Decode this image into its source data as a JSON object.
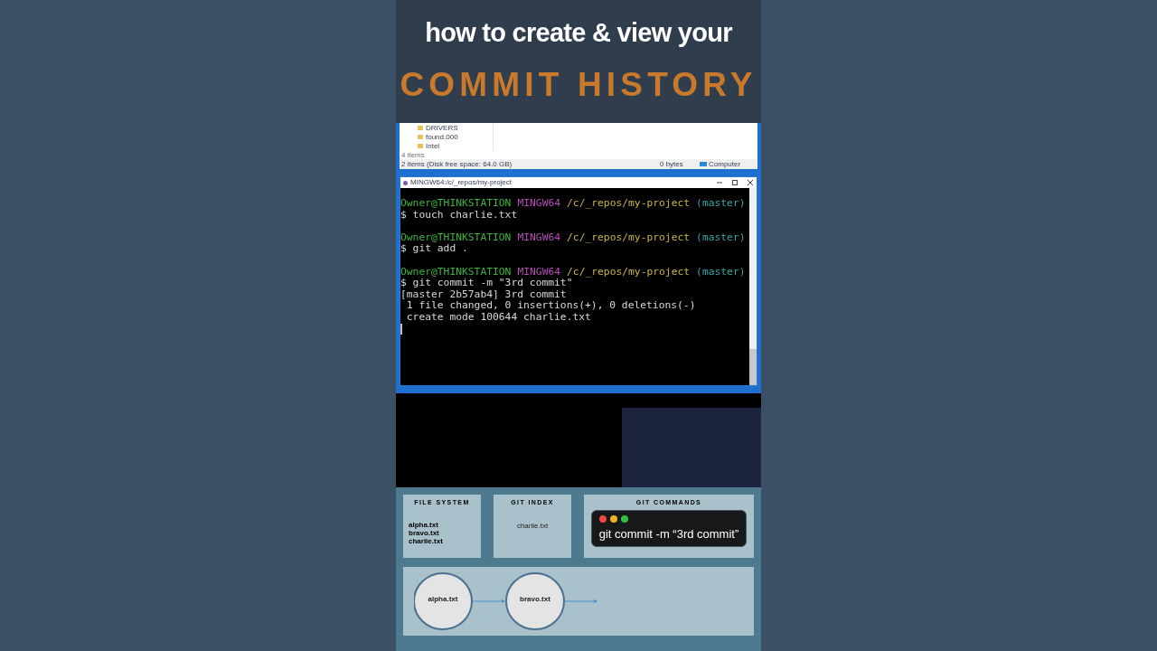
{
  "header": {
    "title": "how to create & view your",
    "subtitle": "COMMIT HISTORY"
  },
  "explorer": {
    "folders": [
      "DRIVERS",
      "found.000",
      "Intel"
    ],
    "item_count": "4 items",
    "status_bar": {
      "selection": "2 items (Disk free space: 64.0 GB)",
      "size": "0 bytes",
      "location": "Computer"
    }
  },
  "terminal": {
    "title": "MINGW64:/c/_repos/my-project",
    "lines": [
      {
        "kind": "prompt",
        "user": "Owner@THINKSTATION",
        "shell": "MINGW64",
        "path": "/c/_repos/my-project",
        "branch": "(master)"
      },
      {
        "kind": "command",
        "text": "$ touch charlie.txt"
      },
      {
        "kind": "prompt",
        "user": "Owner@THINKSTATION",
        "shell": "MINGW64",
        "path": "/c/_repos/my-project",
        "branch": "(master)"
      },
      {
        "kind": "command",
        "text": "$ git add ."
      },
      {
        "kind": "prompt",
        "user": "Owner@THINKSTATION",
        "shell": "MINGW64",
        "path": "/c/_repos/my-project",
        "branch": "(master)"
      },
      {
        "kind": "command",
        "text": "$ git commit -m \"3rd commit\""
      },
      {
        "kind": "output",
        "text": "[master 2b57ab4] 3rd commit"
      },
      {
        "kind": "output",
        "text": " 1 file changed, 0 insertions(+), 0 deletions(-)"
      },
      {
        "kind": "output",
        "text": " create mode 100644 charlie.txt"
      },
      {
        "kind": "cursor"
      }
    ]
  },
  "diagram": {
    "file_system": {
      "title": "FILE SYSTEM",
      "files": [
        "alpha.txt",
        "bravo.txt",
        "charlie.txt"
      ]
    },
    "git_index": {
      "title": "GIT INDEX",
      "files": [
        "charlie.txt"
      ]
    },
    "git_commands": {
      "title": "GIT COMMANDS",
      "command": "git commit -m “3rd commit”"
    },
    "commits": [
      "alpha.txt",
      "bravo.txt"
    ]
  }
}
